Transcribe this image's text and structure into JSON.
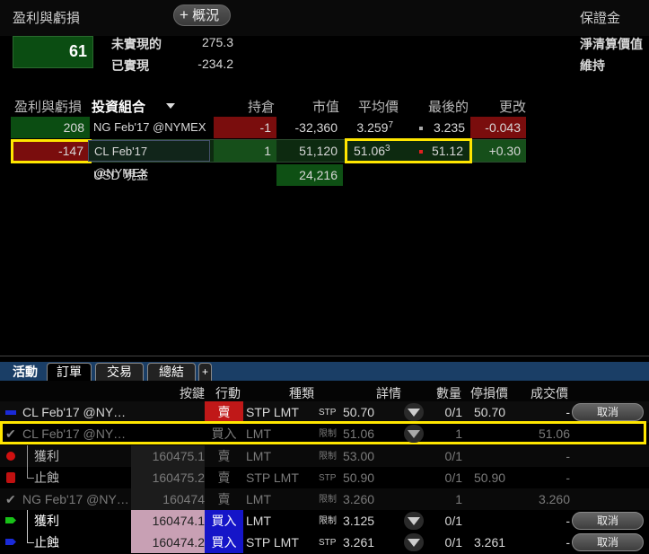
{
  "pnl": {
    "title": "盈利與虧損",
    "overview_label": "概況",
    "total": "61",
    "unrealized_label": "未實現的",
    "unrealized_value": "275.3",
    "realized_label": "已實現",
    "realized_value": "-234.2"
  },
  "margin": {
    "title": "保證金",
    "net_liq_label": "淨清算價值",
    "maint_label": "維持"
  },
  "portfolio": {
    "pnl_header": "盈利與虧損",
    "title": "投資組合",
    "columns": [
      "持倉",
      "市值",
      "平均價",
      "最後的",
      "更改"
    ],
    "rows": [
      {
        "pnl": "208",
        "instrument": "NG Feb'17 @NYMEX",
        "position": "-1",
        "market_value": "-32,360",
        "avg_price": "3.259",
        "avg_price_sup": "7",
        "last": "3.235",
        "change": "-0.043"
      },
      {
        "pnl": "-147",
        "instrument": "CL Feb'17 @NYMEX",
        "position": "1",
        "market_value": "51,120",
        "avg_price": "51.06",
        "avg_price_sup": "3",
        "last": "51.12",
        "change": "+0.30"
      }
    ],
    "cash_label": "USD 現金",
    "cash_value": "24,216"
  },
  "orders": {
    "tabs": [
      "活動",
      "訂單",
      "交易",
      "總結"
    ],
    "columns": [
      "按鍵",
      "行動",
      "種類",
      "詳情",
      "數量",
      "停損價",
      "成交價"
    ],
    "rows": [
      {
        "instrument": "CL Feb'17 @NY…",
        "key": "",
        "action": "賣",
        "type": "STP LMT",
        "detail_tag": "STP",
        "detail_val": "50.70",
        "qty": "0/1",
        "stop": "50.70",
        "fill": "-",
        "cancel": "取消"
      },
      {
        "instrument": "CL Feb'17 @NY…",
        "key": "",
        "action": "買入",
        "type": "LMT",
        "detail_tag": "限制",
        "detail_val": "51.06",
        "qty": "1",
        "stop": "",
        "fill": "51.06",
        "cancel": ""
      },
      {
        "instrument": "獲利",
        "key": "160475.1",
        "action": "賣",
        "type": "LMT",
        "detail_tag": "限制",
        "detail_val": "53.00",
        "qty": "0/1",
        "stop": "",
        "fill": "-",
        "cancel": ""
      },
      {
        "instrument": "止蝕",
        "key": "160475.2",
        "action": "賣",
        "type": "STP LMT",
        "detail_tag": "STP",
        "detail_val": "50.90",
        "qty": "0/1",
        "stop": "50.90",
        "fill": "-",
        "cancel": ""
      },
      {
        "instrument": "NG Feb'17 @NY…",
        "key": "160474",
        "action": "賣",
        "type": "LMT",
        "detail_tag": "限制",
        "detail_val": "3.260",
        "qty": "1",
        "stop": "",
        "fill": "3.260",
        "cancel": ""
      },
      {
        "instrument": "獲利",
        "key": "160474.1",
        "action": "買入",
        "type": "LMT",
        "detail_tag": "限制",
        "detail_val": "3.125",
        "qty": "0/1",
        "stop": "",
        "fill": "-",
        "cancel": "取消"
      },
      {
        "instrument": "止蝕",
        "key": "160474.2",
        "action": "買入",
        "type": "STP LMT",
        "detail_tag": "STP",
        "detail_val": "3.261",
        "qty": "0/1",
        "stop": "3.261",
        "fill": "-",
        "cancel": "取消"
      }
    ]
  },
  "colors": {
    "green": "#0b4d12",
    "red": "#7a0d0d",
    "highlight": "#ffe600",
    "buy": "#1515c8",
    "sell_active": "#c01818",
    "pink": "#c8a0b4"
  }
}
